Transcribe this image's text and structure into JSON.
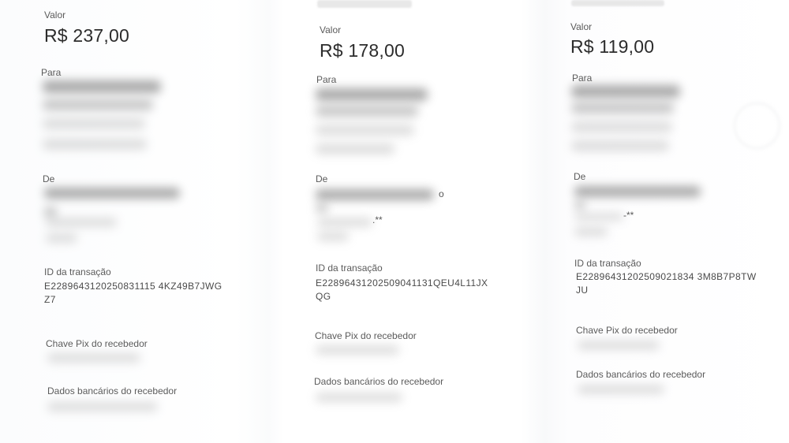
{
  "receipts": [
    {
      "valor_label": "Valor",
      "amount": "R$ 237,00",
      "para_label": "Para",
      "de_label": "De",
      "id_label": "ID da transação",
      "id_line1": "E2289643120250831115 4KZ49B7JWG",
      "id_line2": "Z7",
      "chave_label": "Chave Pix do recebedor",
      "dados_label": "Dados bancários do recebedor"
    },
    {
      "valor_label": "Valor",
      "amount": "R$ 178,00",
      "para_label": "Para",
      "de_label": "De",
      "de_fragment": "o",
      "masked_fragment": ".**",
      "id_label": "ID da transação",
      "id_line1": "E22896431202509041131QEU4L11JX",
      "id_line2": "QG",
      "chave_label": "Chave Pix do recebedor",
      "dados_label": "Dados bancários do recebedor"
    },
    {
      "valor_label": "Valor",
      "amount": "R$ 119,00",
      "para_label": "Para",
      "de_label": "De",
      "masked_fragment": "-**",
      "id_label": "ID da transação",
      "id_line1": "E22896431202509021834 3M8B7P8TW",
      "id_line2": "JU",
      "chave_label": "Chave Pix do recebedor",
      "dados_label": "Dados bancários do recebedor"
    }
  ]
}
